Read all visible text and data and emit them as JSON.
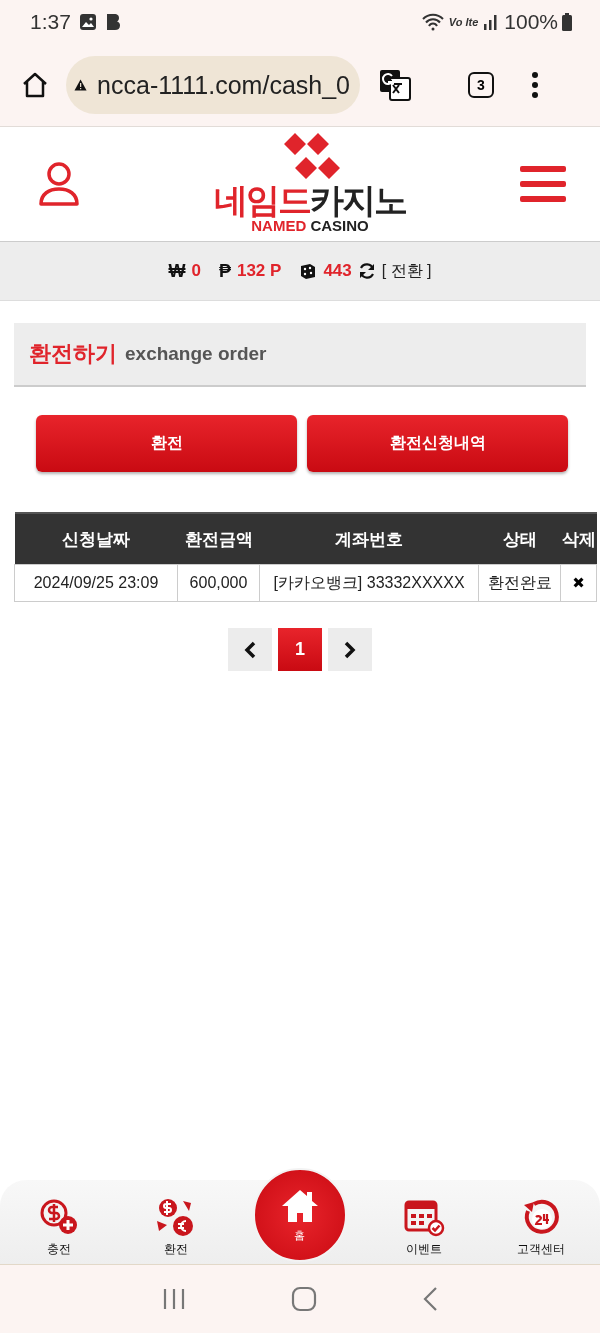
{
  "status_bar": {
    "time": "1:37",
    "network": "Vo lte",
    "battery": "100%"
  },
  "browser": {
    "url": "ncca-1111.com/cash_0",
    "tab_count": "3"
  },
  "logo": {
    "red_text": "네임드",
    "dark_text": "카지노",
    "sub_red": "NAMED",
    "sub_dark": "CASINO"
  },
  "balance": {
    "won_symbol": "₩",
    "won": "0",
    "point_symbol": "₱",
    "points": "132 P",
    "chips": "443",
    "convert": "[ 전환 ]"
  },
  "page_title": {
    "korean": "환전하기",
    "english": "exchange order"
  },
  "buttons": [
    {
      "label": "환전"
    },
    {
      "label": "환전신청내역"
    }
  ],
  "table": {
    "columns": [
      "신청날짜",
      "환전금액",
      "계좌번호",
      "상태",
      "삭제"
    ],
    "rows": [
      {
        "date": "2024/09/25 23:09",
        "amount": "600,000",
        "account": "[카카오뱅크] 33332XXXXX",
        "status": "환전완료",
        "delete": "✖"
      }
    ]
  },
  "pagination": {
    "pages": [
      {
        "label": "1",
        "selected": true
      }
    ]
  },
  "bottom_nav": [
    {
      "label": "충전",
      "kind": "flat"
    },
    {
      "label": "환전",
      "kind": "flat"
    },
    {
      "label": "홈",
      "kind": "raised"
    },
    {
      "label": "이벤트",
      "kind": "flat"
    },
    {
      "label": "고객센터",
      "kind": "flat"
    }
  ]
}
